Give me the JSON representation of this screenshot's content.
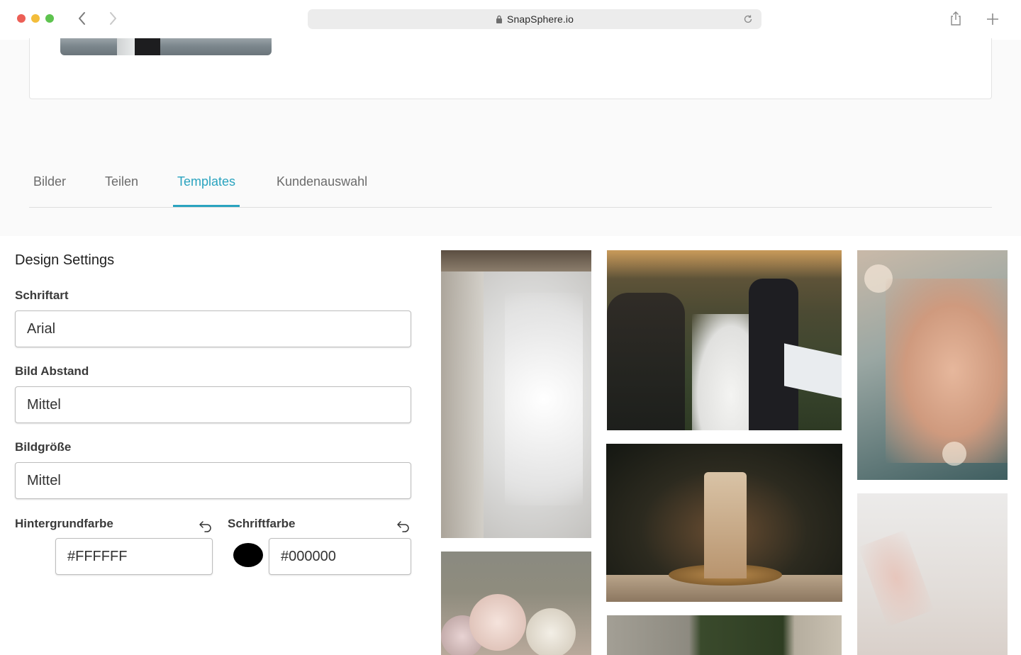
{
  "browser": {
    "url": "SnapSphere.io",
    "lock_icon": "lock-icon",
    "reload_icon": "reload-icon",
    "share_icon": "share-icon",
    "new_tab_icon": "plus-icon",
    "back_icon": "chevron-left-icon",
    "forward_icon": "chevron-right-icon"
  },
  "tabs": [
    {
      "label": "Bilder",
      "active": false
    },
    {
      "label": "Teilen",
      "active": false
    },
    {
      "label": "Templates",
      "active": true
    },
    {
      "label": "Kundenauswahl",
      "active": false
    }
  ],
  "design_settings": {
    "title": "Design Settings",
    "font": {
      "label": "Schriftart",
      "value": "Arial"
    },
    "image_spacing": {
      "label": "Bild Abstand",
      "value": "Mittel"
    },
    "image_size": {
      "label": "Bildgröße",
      "value": "Mittel"
    },
    "background_color": {
      "label": "Hintergrundfarbe",
      "value": "#FFFFFF",
      "swatch": "#FFFFFF"
    },
    "font_color": {
      "label": "Schriftfarbe",
      "value": "#000000",
      "swatch": "#000000"
    }
  },
  "colors": {
    "accent": "#2aa3bf",
    "page_background": "#fafafa",
    "tab_inactive": "#6b6b6b"
  },
  "gallery": [
    {
      "subject": "wedding-dress-detail"
    },
    {
      "subject": "wedding-party-champagne"
    },
    {
      "subject": "hands-with-rings"
    },
    {
      "subject": "wedding-cake"
    },
    {
      "subject": "veil-and-hand"
    },
    {
      "subject": "bridal-bouquet"
    },
    {
      "subject": "venue-building"
    }
  ]
}
